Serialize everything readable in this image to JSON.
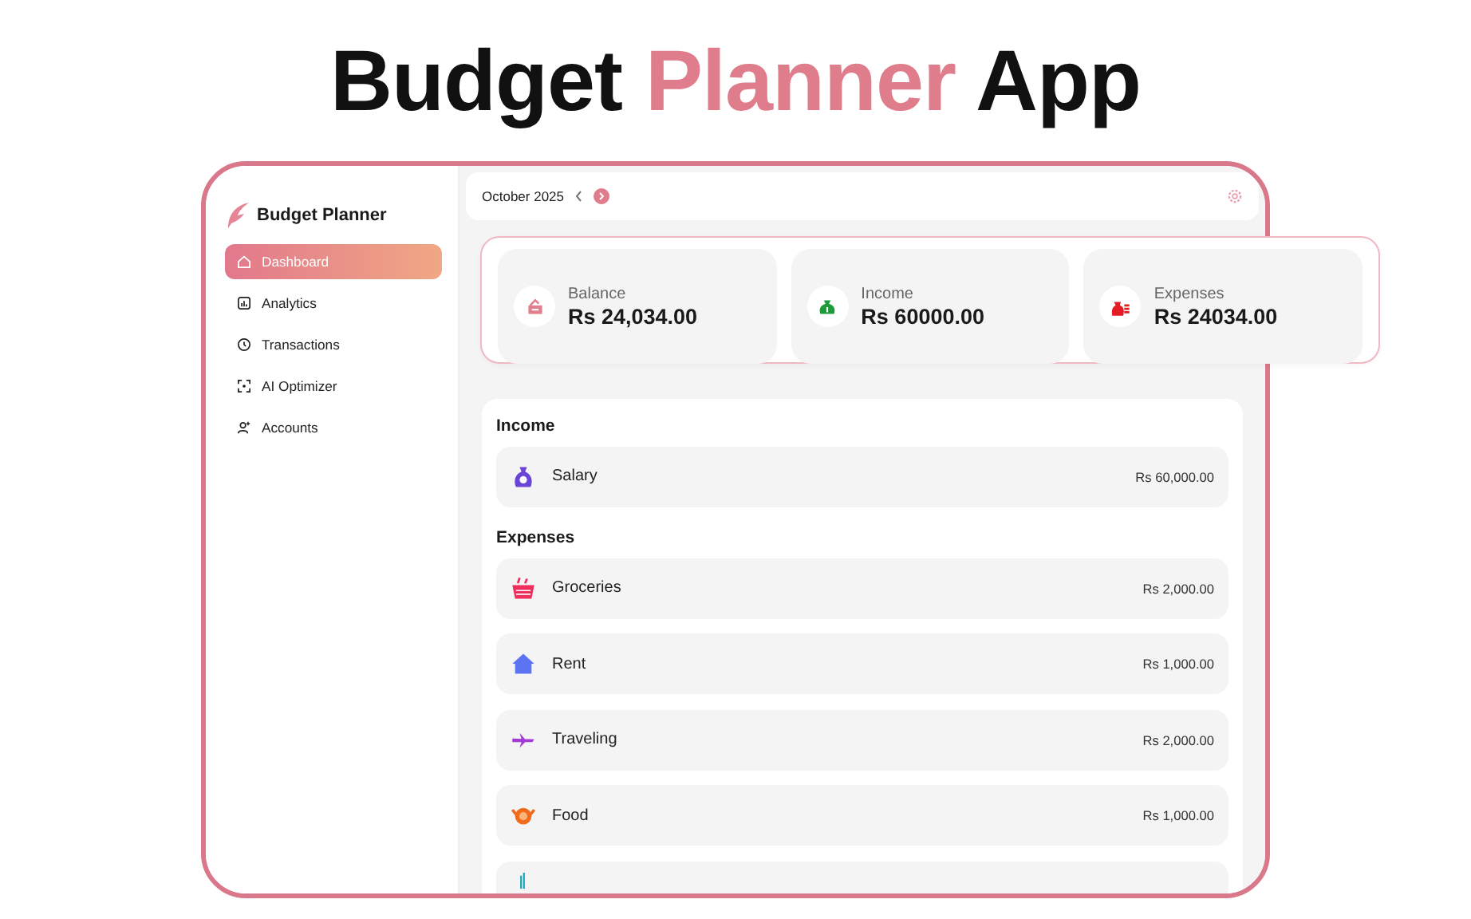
{
  "heading": [
    {
      "text": "Budget",
      "accent": false
    },
    {
      "text": "Planner",
      "accent": true
    },
    {
      "text": "App",
      "accent": false
    }
  ],
  "sidebar": {
    "brand": "Budget Planner",
    "items": [
      {
        "label": "Dashboard",
        "kind": "home",
        "selected": true
      },
      {
        "label": "Analytics",
        "kind": "chart",
        "selected": false
      },
      {
        "label": "Transactions",
        "kind": "clock",
        "selected": false
      },
      {
        "label": "AI Optimizer",
        "kind": "scan",
        "selected": false
      },
      {
        "label": "Accounts",
        "kind": "user",
        "selected": false
      }
    ]
  },
  "topbar": {
    "month": "October 2025"
  },
  "summary": [
    {
      "label": "Balance",
      "value": "Rs 24,034.00",
      "kind": "wallet"
    },
    {
      "label": "Income",
      "value": "Rs 60000.00",
      "kind": "moneybag"
    },
    {
      "label": "Expenses",
      "value": "Rs 24034.00",
      "kind": "bill"
    }
  ],
  "sections": [
    {
      "title": "Income",
      "rows": [
        {
          "label": "Salary",
          "amount": "Rs 60,000.00",
          "kind": "bag"
        }
      ]
    },
    {
      "title": "Expenses",
      "rows": [
        {
          "label": "Groceries",
          "amount": "Rs 2,000.00",
          "kind": "basket"
        },
        {
          "label": "Rent",
          "amount": "Rs 1,000.00",
          "kind": "house"
        },
        {
          "label": "Traveling",
          "amount": "Rs 2,000.00",
          "kind": "plane"
        },
        {
          "label": "Food",
          "amount": "Rs 1,000.00",
          "kind": "food"
        },
        {
          "kind": "drink"
        }
      ]
    }
  ]
}
